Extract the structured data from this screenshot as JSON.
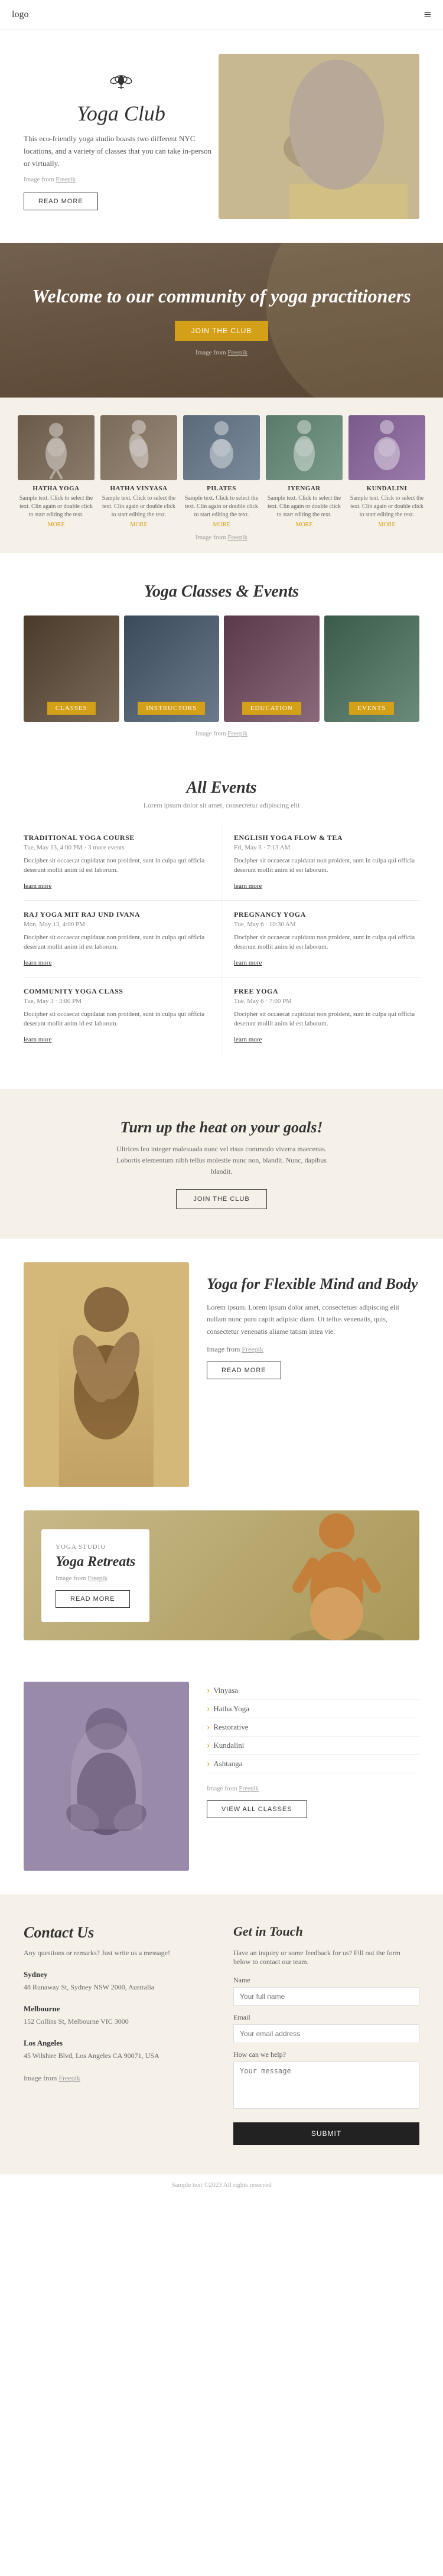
{
  "header": {
    "logo": "logo",
    "menu_icon": "≡"
  },
  "hero": {
    "logo_icon": "🌸",
    "brand": "Yoga Club",
    "description": "This eco-friendly yoga studio boasts two different NYC locations, and a variety of classes that you can take in-person or virtually.",
    "img_credit_prefix": "Image from",
    "img_credit_link": "Freepik",
    "read_more": "READ MORE"
  },
  "welcome": {
    "heading": "Welcome to our community of yoga practitioners",
    "join_cta": "JOIN THE CLUB",
    "img_credit_prefix": "Image from",
    "img_credit_link": "Freepik"
  },
  "yoga_types": {
    "types": [
      {
        "id": "hatha",
        "title": "HATHA YOGA",
        "desc": "Sample text. Click to select the text. Clin again or double click to start editing the text.",
        "more": "MORE"
      },
      {
        "id": "vinyasa",
        "title": "HATHA VINYASA",
        "desc": "Sample text. Click to select the text. Clin again or double click to start editing the text.",
        "more": "MORE"
      },
      {
        "id": "pilates",
        "title": "PILATES",
        "desc": "Sample text. Click to select the text. Clin again or double click to start editing the text.",
        "more": "MORE"
      },
      {
        "id": "iyengar",
        "title": "IYENGAR",
        "desc": "Sample text. Click to select the text. Clin again or double click to start editing the text.",
        "more": "MORE"
      },
      {
        "id": "kundalini",
        "title": "KUNDALINI",
        "desc": "Sample text. Click to select the text. Clin again or double click to start editing the text.",
        "more": "MORE"
      }
    ],
    "credit_prefix": "Image from",
    "credit_link": "Freepik"
  },
  "classes_events": {
    "heading": "Yoga Classes & Events",
    "cards": [
      {
        "id": "classes",
        "label": "CLASSES"
      },
      {
        "id": "instructors",
        "label": "INSTRUCTORS"
      },
      {
        "id": "education",
        "label": "EDUCATION"
      },
      {
        "id": "events",
        "label": "EVENTS"
      }
    ],
    "credit_prefix": "Image from",
    "credit_link": "Freepik"
  },
  "all_events": {
    "heading": "All Events",
    "lorem": "Lorem ipsum dolor sit amet, consectetur adipiscing elit",
    "events": [
      {
        "title": "TRADITIONAL YOGA COURSE",
        "date": "Tue, May 13, 4:00 PM · 3 more events",
        "desc": "Docipher sit occaecat cupidatat non proident, sunt in culpa qui officia deserunt mollit anim id est laborum.",
        "link": "learn more"
      },
      {
        "title": "ENGLISH YOGA FLOW & TEA",
        "date": "Fri, May 3 · 7:13 AM",
        "desc": "Docipher sit occaecat cupidatat non proident, sunt in culpa qui officia deserunt mollit anim id est laborum.",
        "link": "learn more"
      },
      {
        "title": "RAJ YOGA MIT RAJ UND IVANA",
        "date": "Mon, May 13, 4:00 PM",
        "desc": "Docipher sit occaecat cupidatat non proident, sunt in culpa qui officia deserunt mollit anim id est laborum.",
        "link": "learn more"
      },
      {
        "title": "PREGNANCY YOGA",
        "date": "Tue, May 6 · 10:30 AM",
        "desc": "Docipher sit occaecat cupidatat non proident, sunt in culpa qui officia deserunt mollit anim id est laborum.",
        "link": "learn more"
      },
      {
        "title": "COMMUNITY YOGA CLASS",
        "date": "Tue, May 3 · 3:00 PM",
        "desc": "Docipher sit occaecat cupidatat non proident, sunt in culpa qui officia deserunt mollit anim id est laborum.",
        "link": "learn more"
      },
      {
        "title": "FREE YOGA",
        "date": "Tue, May 6 · 7:00 PM",
        "desc": "Docipher sit occaecat cupidatat non proident, sunt in culpa qui officia deserunt mollit anim id est laborum.",
        "link": "learn more"
      }
    ]
  },
  "cta_banner": {
    "heading": "Turn up the heat on your goals!",
    "desc": "Ultrices leo integer malesuada nunc vel risus commodo viverra maecenas. Lobortis elementum nibh tellus molestie nunc non, blandit. Nunc, dapibus blandit.",
    "btn": "JOIN THE CLUB"
  },
  "flex_mind": {
    "heading": "Yoga for Flexible Mind and Body",
    "desc": "Lorem ipsum. Lorem ipsum dolor amet, consectetuer adipiscing elit nullam nunc puru captit adipisic diam. Ut tellus venenatis, quis, consectetur venenatis aliame tatism intea vie.",
    "credit_prefix": "Image from",
    "credit_link": "Freepik",
    "btn": "READ MORE"
  },
  "retreats": {
    "label": "YOGA STUDIO",
    "heading": "Yoga Retreats",
    "credit_prefix": "Image from",
    "credit_link": "Freepik",
    "btn": "READ MORE"
  },
  "classes_list": {
    "items": [
      "Vinyasa",
      "Hatha Yoga",
      "Restorative",
      "Kundalini",
      "Ashtanga"
    ],
    "credit_prefix": "Image from",
    "credit_link": "Freepik",
    "btn": "VIEW ALL CLASSES"
  },
  "contact": {
    "heading": "Contact Us",
    "intro": "Any questions or remarks? Just write us a message!",
    "locations": [
      {
        "city": "Sydney",
        "address": "48 Runaway St, Sydney NSW 2000, Australia"
      },
      {
        "city": "Melbourne",
        "address": "152 Collins St, Melbourne VIC 3000"
      },
      {
        "city": "Los Angeles",
        "address": "45 Wilshire Blvd, Los Angeles CA 90071, USA"
      }
    ],
    "credit_prefix": "Image from",
    "credit_link": "Freepik"
  },
  "get_in_touch": {
    "heading": "Get in Touch",
    "desc": "Have an inquiry or some feedback for us? Fill out the form below to contact our team.",
    "form": {
      "name_label": "Name",
      "name_placeholder": "Your full name",
      "email_label": "Email",
      "email_placeholder": "Your email address",
      "message_label": "How can we help?",
      "message_placeholder": "Your message",
      "submit": "SUBMIT"
    }
  },
  "footer": {
    "sample_text": "Sample text ©2023 All rights reserved"
  }
}
